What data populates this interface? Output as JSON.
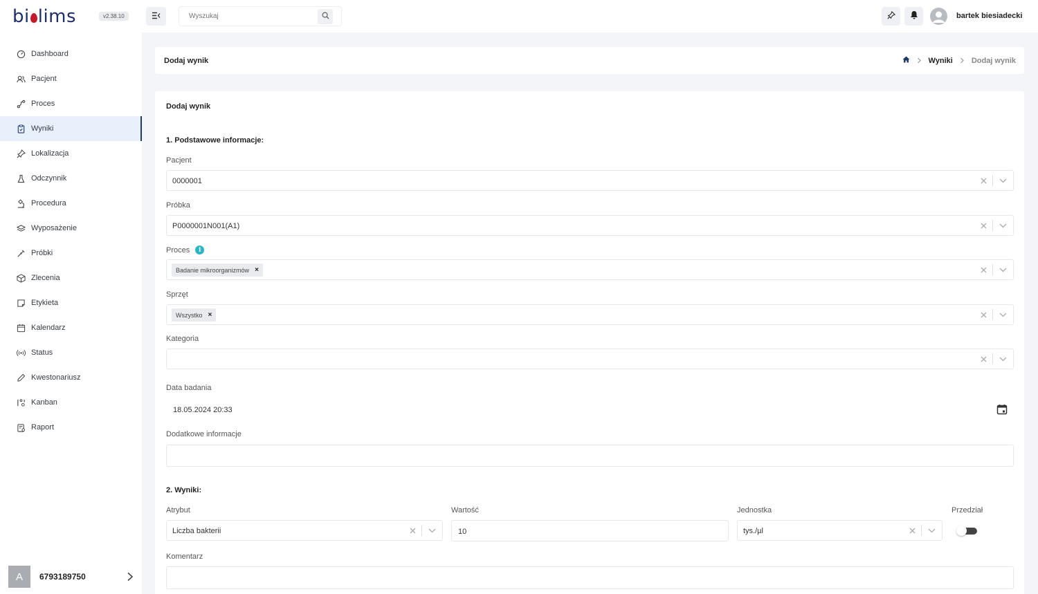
{
  "app": {
    "logo_text": "bi lims",
    "version": "v2.38.10"
  },
  "sidebar": {
    "items": [
      {
        "label": "Dashboard",
        "icon": "dashboard-icon"
      },
      {
        "label": "Pacjent",
        "icon": "users-icon"
      },
      {
        "label": "Proces",
        "icon": "route-icon"
      },
      {
        "label": "Wyniki",
        "icon": "clipboard-icon",
        "active": true
      },
      {
        "label": "Lokalizacja",
        "icon": "pin-icon"
      },
      {
        "label": "Odczynnik",
        "icon": "flask-icon"
      },
      {
        "label": "Procedura",
        "icon": "microscope-icon"
      },
      {
        "label": "Wyposażenie",
        "icon": "layers-icon"
      },
      {
        "label": "Próbki",
        "icon": "pipette-icon"
      },
      {
        "label": "Zlecenia",
        "icon": "box-icon"
      },
      {
        "label": "Etykieta",
        "icon": "note-icon"
      },
      {
        "label": "Kalendarz",
        "icon": "calendar-icon"
      },
      {
        "label": "Status",
        "icon": "broadcast-icon"
      },
      {
        "label": "Kwestonariusz",
        "icon": "pen-icon"
      },
      {
        "label": "Kanban",
        "icon": "kanban-icon"
      },
      {
        "label": "Raport",
        "icon": "report-icon"
      }
    ],
    "footer": {
      "avatar_letter": "A",
      "name": "6793189750"
    }
  },
  "topbar": {
    "search_placeholder": "Wyszukaj",
    "user_name": "bartek biesiadecki"
  },
  "header": {
    "title": "Dodaj wynik",
    "breadcrumb": [
      "Wyniki",
      "Dodaj wynik"
    ]
  },
  "form": {
    "title": "Dodaj wynik",
    "section1": "1. Podstawowe informacje:",
    "pacjent": {
      "label": "Pacjent",
      "value": "0000001"
    },
    "probka": {
      "label": "Próbka",
      "value": "P0000001N001(A1)"
    },
    "proces": {
      "label": "Proces",
      "chip": "Badanie mikroorganizmów"
    },
    "sprzet": {
      "label": "Sprzęt",
      "chip": "Wszystko"
    },
    "kategoria": {
      "label": "Kategoria",
      "value": ""
    },
    "data_badania": {
      "label": "Data badania",
      "value": "18.05.2024 20:33"
    },
    "dodatkowe": {
      "label": "Dodatkowe informacje",
      "value": ""
    },
    "section2": "2. Wyniki:",
    "atrybut": {
      "label": "Atrybut",
      "value": "Liczba bakterii"
    },
    "wartosc": {
      "label": "Wartość",
      "value": "10"
    },
    "jednostka": {
      "label": "Jednostka",
      "value": "tys./µl"
    },
    "przedzial": {
      "label": "Przedział",
      "enabled": false
    },
    "komentarz": {
      "label": "Komentarz",
      "value": ""
    }
  },
  "colors": {
    "accent": "#1e3a6e",
    "logo_red": "#c4182b",
    "info": "#29b7c6"
  }
}
